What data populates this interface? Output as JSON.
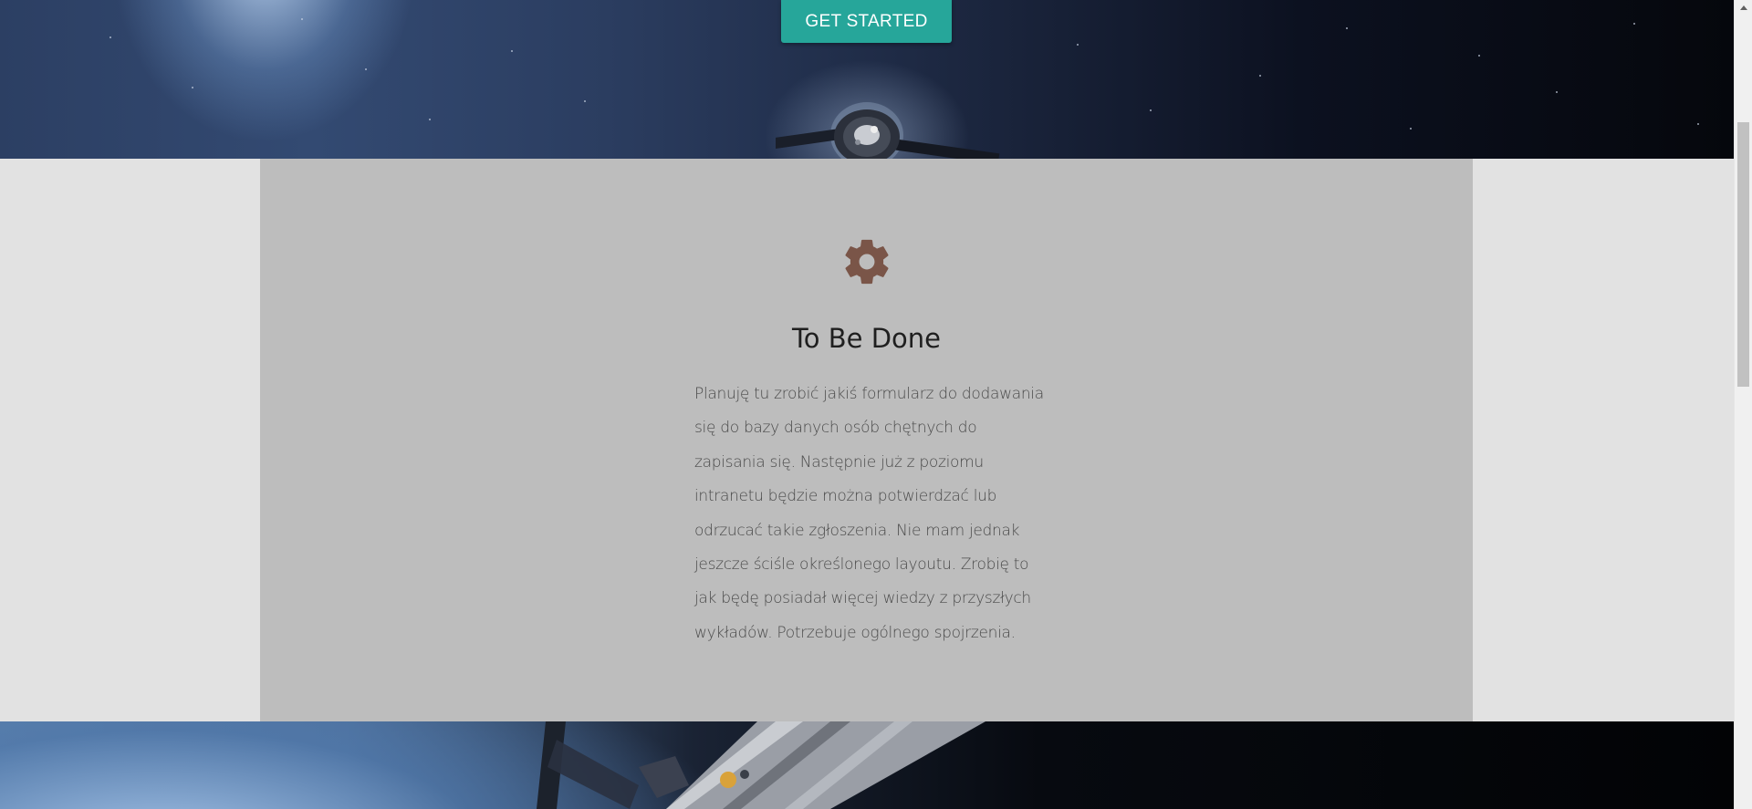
{
  "hero": {
    "cta_label": "GET STARTED"
  },
  "card": {
    "icon": "gear-icon",
    "title": "To Be Done",
    "body": "Planuję tu zrobić jakiś formularz do dodawania się do bazy danych osób chętnych do zapisania się. Następnie już z poziomu intranetu będzie można potwierdzać lub odrzucać takie zgłoszenia. Nie mam jednak jeszcze ściśle określonego layoutu. Zrobię to jak będę posiadał więcej wiedzy z przyszłych wykładów. Potrzebuje ogólnego spojrzenia."
  },
  "colors": {
    "accent": "#26a69a",
    "card_background": "#bdbdbd",
    "section_background": "#e2e2e2",
    "gear_color": "#7a5548"
  }
}
